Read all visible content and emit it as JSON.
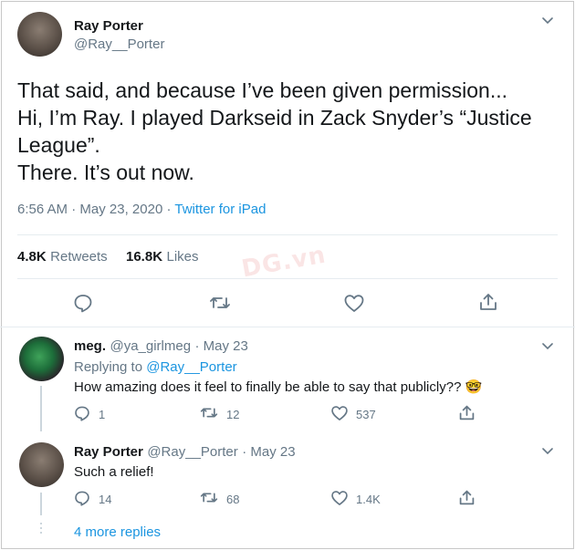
{
  "main_tweet": {
    "author_name": "Ray Porter",
    "author_handle": "@Ray__Porter",
    "text_lines": [
      "That said, and because I’ve been given permission...",
      "Hi, I’m Ray. I played Darkseid in Zack Snyder’s “Justice",
      "League”.",
      "There. It’s out now."
    ],
    "time": "6:56 AM",
    "date": "May 23, 2020",
    "source": "Twitter for iPad",
    "separator": "·",
    "retweets_count": "4.8K",
    "retweets_label": "Retweets",
    "likes_count": "16.8K",
    "likes_label": "Likes"
  },
  "replies": [
    {
      "author_name": "meg.",
      "author_handle": "@ya_girlmeg",
      "date": "· May 23",
      "replying_label": "Replying to",
      "replying_to": "@Ray__Porter",
      "text": "How amazing does it feel to finally be able to say that publicly??",
      "emoji": "🤓",
      "reply_count": "1",
      "retweet_count": "12",
      "like_count": "537"
    },
    {
      "author_name": "Ray Porter",
      "author_handle": "@Ray__Porter",
      "date": "· May 23",
      "text": "Such a relief!",
      "reply_count": "14",
      "retweet_count": "68",
      "like_count": "1.4K"
    }
  ],
  "more_replies": "4 more replies",
  "colors": {
    "accent": "#1b95e0",
    "icon_gray": "#657786",
    "divider": "#e6ecf0"
  },
  "icons": {
    "reply": "reply-icon",
    "retweet": "retweet-icon",
    "like": "heart-icon",
    "share": "share-icon",
    "menu": "chevron-down-icon"
  }
}
